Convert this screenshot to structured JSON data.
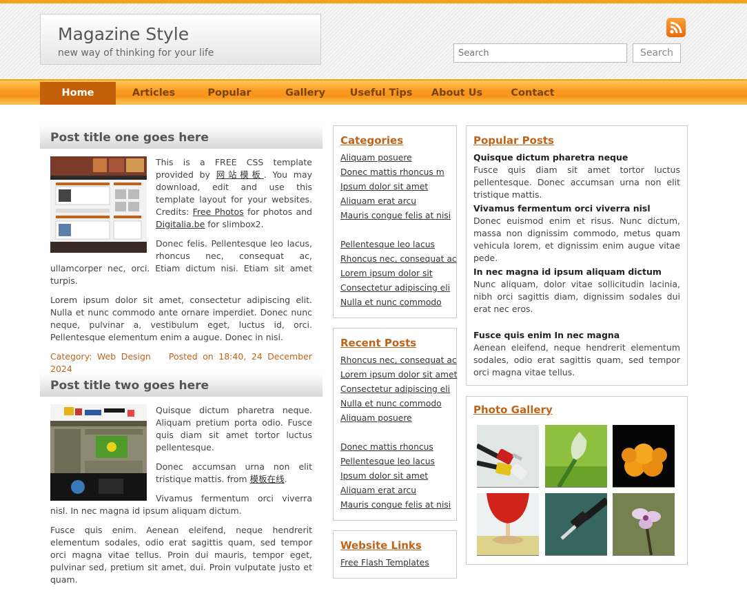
{
  "header": {
    "title": "Magazine Style",
    "tagline": "new way of thinking for your life",
    "rss_icon": "rss-icon",
    "search_placeholder": "Search",
    "search_button": "Search"
  },
  "nav": {
    "items": [
      "Home",
      "Articles",
      "Popular",
      "Gallery",
      "Useful Tips",
      "About Us",
      "Contact"
    ],
    "active": "Home"
  },
  "posts": [
    {
      "title": "Post title one goes here",
      "p1_pre": "This is a FREE CSS template provided by ",
      "p1_link1": "网站模板",
      "p1_mid1": ". You may download, edit and use this template layout for your websites. Credits: ",
      "p1_link2": "Free Photos",
      "p1_mid2": " for photos and ",
      "p1_link3": "Digitalia.be",
      "p1_post": " for slimbox2.",
      "p2": "Donec felis. Pellentesque leo lacus, rhoncus nec, consequat ac, ullamcorper nec, orci. Etiam dictum nisi. Etiam sit amet turpis.",
      "p3": "Lorem ipsum dolor sit amet, consectetur adipiscing elit. Nulla et nunc commodo ante ornare imperdiet. Donec nunc neque, pulvinar a, vestibulum eget, luctus id, orci. Pellentesque elementum enim a augue. Donec in nisi.",
      "category": "Category: Web Design",
      "posted": "Posted on 18:40, 24 December 2024"
    },
    {
      "title": "Post title two goes here",
      "p1": "Quisque dictum pharetra neque. Aliquam pretium porta odio. Fusce quis diam sit amet tortor luctus pellentesque.",
      "p2_pre": "Donec accumsan urna non elit tristique mattis. from ",
      "p2_link": "模板在线",
      "p2_post": ".",
      "p3": "Vivamus fermentum orci viverra nisl. In nec magna id ipsum aliquam dictum.",
      "p4": "Fusce quis enim. Aenean eleifend, neque hendrerit elementum sodales, odio erat sagittis quam, sed tempor orci magna vitae tellus. Proin dui mauris, tempor eget, pulvinar sed, pretium sit amet, dui. Proin vulputate justo et quam."
    }
  ],
  "categories": {
    "title": "Categories",
    "items": [
      "Aliquam posuere",
      "Donec mattis rhoncus m",
      "Ipsum dolor sit amet",
      "Aliquam erat arcu",
      "Mauris congue felis at nisi",
      "Pellentesque leo lacus",
      "Rhoncus nec, consequat ac",
      "Lorem ipsum dolor sit",
      "Consectetur adipiscing eli",
      "Nulla et nunc commodo"
    ]
  },
  "recent_posts": {
    "title": "Recent Posts",
    "items": [
      "Rhoncus nec, consequat ac",
      "Lorem ipsum dolor sit amet",
      "Consectetur adipiscing eli",
      "Nulla et nunc commodo",
      "Aliquam posuere",
      "Donec mattis rhoncus",
      "Pellentesque leo lacus",
      "Ipsum dolor sit amet",
      "Aliquam erat arcu",
      "Mauris congue felis at nisi"
    ]
  },
  "website_links": {
    "title": "Website Links",
    "items": [
      "Free Flash Templates"
    ]
  },
  "popular_posts": {
    "title": "Popular Posts",
    "items": [
      {
        "head": "Quisque dictum pharetra neque",
        "body": "Fusce quis diam sit amet tortor luctus pellentesque. Donec accumsan urna non elit tristique mattis."
      },
      {
        "head": "Vivamus fermentum orci viverra nisl",
        "body": "Donec euismod enim et risus. Nunc dictum, massa non dignissim commodo, metus quam vehicula lorem, et dignissim enim augue vitae pede."
      },
      {
        "head": "In nec magna id ipsum aliquam dictum",
        "body": "Nunc aliquam, dolor vitae sollicitudin lacinia, nibh orci sagittis diam, dignissim sodales dui erat nec eros."
      },
      {
        "head": "Fusce quis enim In nec magna",
        "body": "Aenean eleifend, neque hendrerit elementum sodales, odio erat sagittis quam, sed tempor orci magna vitae tellus."
      }
    ]
  },
  "photo_gallery": {
    "title": "Photo Gallery"
  },
  "colors": {
    "accent": "#f7931a",
    "nav_active": "#c5600a",
    "link_heading": "#c0641a"
  }
}
